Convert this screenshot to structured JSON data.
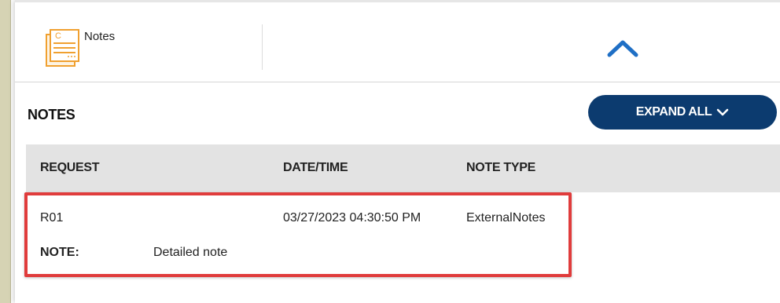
{
  "tab": {
    "label": "Notes",
    "icon": "notes-document-icon",
    "icon_color": "#f0a030"
  },
  "header": {
    "collapse_icon": "chevron-up-icon",
    "accent_color": "#1f6fc5"
  },
  "section": {
    "title": "NOTES",
    "expand_label": "EXPAND ALL",
    "expand_icon": "chevron-down-icon",
    "button_color": "#0c3b6f"
  },
  "table": {
    "columns": {
      "request": "REQUEST",
      "datetime": "DATE/TIME",
      "note_type": "NOTE TYPE"
    },
    "rows": [
      {
        "request": "R01",
        "datetime": "03/27/2023 04:30:50 PM",
        "note_type": "ExternalNotes",
        "note_label": "NOTE:",
        "note_text": "Detailed note"
      }
    ],
    "highlight_color": "#e03c3c"
  }
}
